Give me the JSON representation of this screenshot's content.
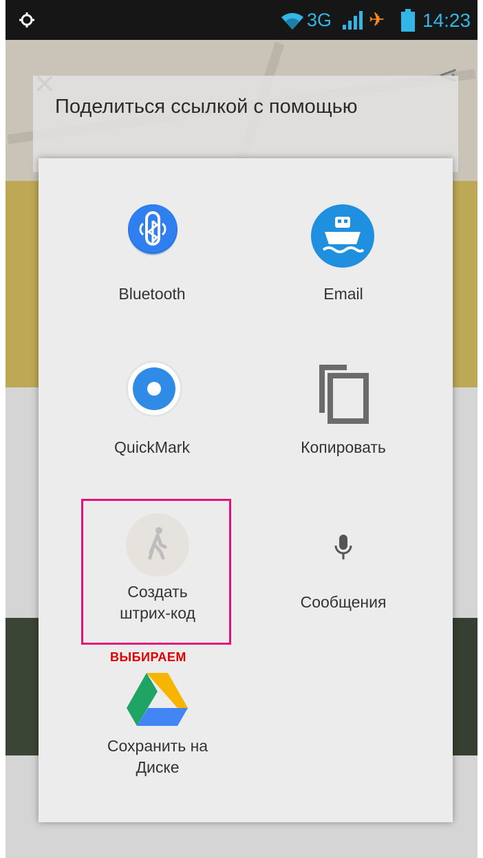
{
  "status_bar": {
    "network": "3G",
    "time": "14:23",
    "icons": [
      "gps-icon",
      "wifi-icon",
      "signal-icon",
      "airplane-icon",
      "battery-icon"
    ]
  },
  "share_dialog": {
    "title": "Поделиться ссылкой с помощью",
    "items": [
      {
        "label": "Bluetooth",
        "icon": "bluetooth-icon",
        "color": "#2a78e8"
      },
      {
        "label": "Email",
        "icon": "ship-icon",
        "color": "#1f8fe0"
      },
      {
        "label": "QuickMark",
        "icon": "quickmark-icon",
        "color": "#2f8be6"
      },
      {
        "label": "Копировать",
        "icon": "copy-icon",
        "color": "#6b6b6b"
      },
      {
        "label": "Создать штрих-код",
        "icon": "walker-icon",
        "color": "#bdbdbd"
      },
      {
        "label": "Сообщения",
        "icon": "microphone-icon",
        "color": "#555555"
      },
      {
        "label": "Сохранить на Диске",
        "icon": "google-drive-icon",
        "color": "#1fa463"
      }
    ]
  },
  "annotation": {
    "label": "ВЫБИРАЕМ",
    "color": "#e2127a"
  }
}
